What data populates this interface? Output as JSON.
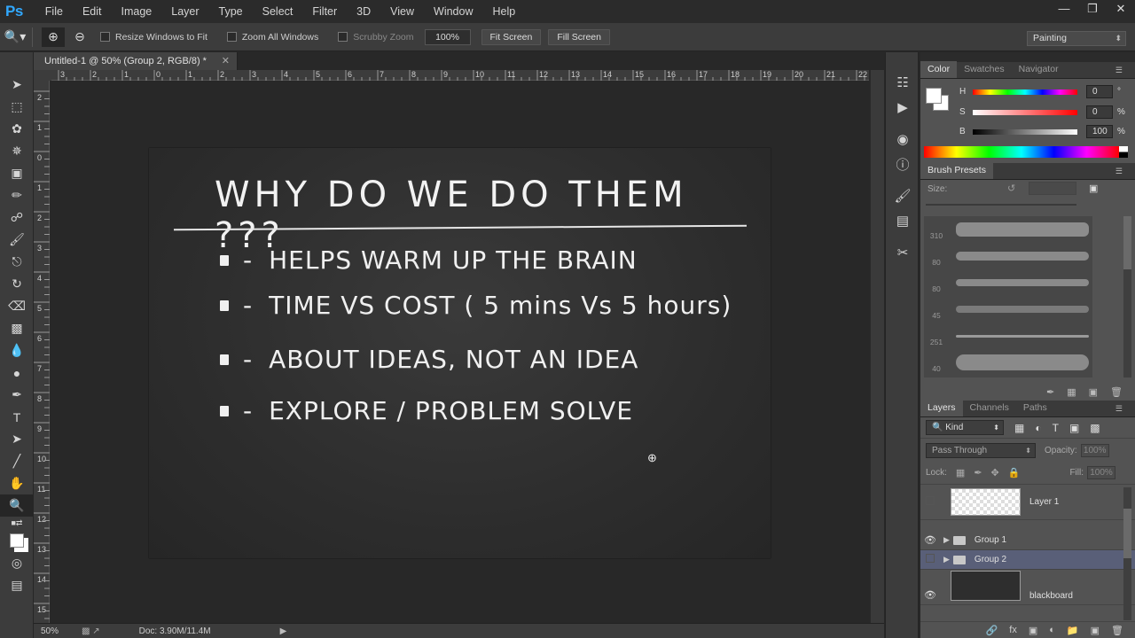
{
  "app": {
    "logo": "Ps"
  },
  "menu": [
    "File",
    "Edit",
    "Image",
    "Layer",
    "Type",
    "Select",
    "Filter",
    "3D",
    "View",
    "Window",
    "Help"
  ],
  "window_controls": {
    "minimize": "—",
    "restore": "❐",
    "close": "✕"
  },
  "options": {
    "resize_windows": "Resize Windows to Fit",
    "zoom_all": "Zoom All Windows",
    "scrubby_zoom": "Scrubby Zoom",
    "zoom_value": "100%",
    "fit_screen": "Fit Screen",
    "fill_screen": "Fill Screen",
    "workspace": "Painting"
  },
  "document": {
    "tab_title": "Untitled-1 @ 50% (Group 2, RGB/8) *",
    "zoom": "50%",
    "doc_info": "Doc: 3.90M/11.4M"
  },
  "canvas": {
    "title": "WHY DO WE DO THEM ???",
    "bullets": [
      "HELPS WARM UP THE BRAIN",
      "TIME VS COST ( 5 mins Vs 5 hours)",
      "ABOUT IDEAS, NOT AN IDEA",
      "EXPLORE / PROBLEM SOLVE"
    ],
    "dash": "-"
  },
  "rulers": {
    "h": [
      "3",
      "2",
      "1",
      "0",
      "1",
      "2",
      "3",
      "4",
      "5",
      "6",
      "7",
      "8",
      "9",
      "10",
      "11",
      "12",
      "13",
      "14",
      "15",
      "16",
      "17",
      "18",
      "19",
      "20",
      "21",
      "22"
    ],
    "v": [
      "2",
      "1",
      "0",
      "1",
      "2",
      "3",
      "4",
      "5",
      "6",
      "7",
      "8",
      "9",
      "10",
      "11",
      "12",
      "13",
      "14",
      "15"
    ]
  },
  "color_panel": {
    "tabs": [
      "Color",
      "Swatches",
      "Navigator"
    ],
    "h": {
      "label": "H",
      "value": "0",
      "unit": "°"
    },
    "s": {
      "label": "S",
      "value": "0",
      "unit": "%"
    },
    "b": {
      "label": "B",
      "value": "100",
      "unit": "%"
    }
  },
  "brush_presets": {
    "tab": "Brush Presets",
    "size_label": "Size:",
    "sizes": [
      "310",
      "80",
      "80",
      "45",
      "251",
      "40"
    ]
  },
  "layers_panel": {
    "tabs": [
      "Layers",
      "Channels",
      "Paths"
    ],
    "kind": "Kind",
    "blend_mode": "Pass Through",
    "opacity_label": "Opacity:",
    "opacity": "100%",
    "lock_label": "Lock:",
    "fill_label": "Fill:",
    "fill": "100%",
    "layers": [
      {
        "name": "Layer 1"
      },
      {
        "name": "Group 1"
      },
      {
        "name": "Group 2"
      },
      {
        "name": "blackboard"
      }
    ]
  }
}
